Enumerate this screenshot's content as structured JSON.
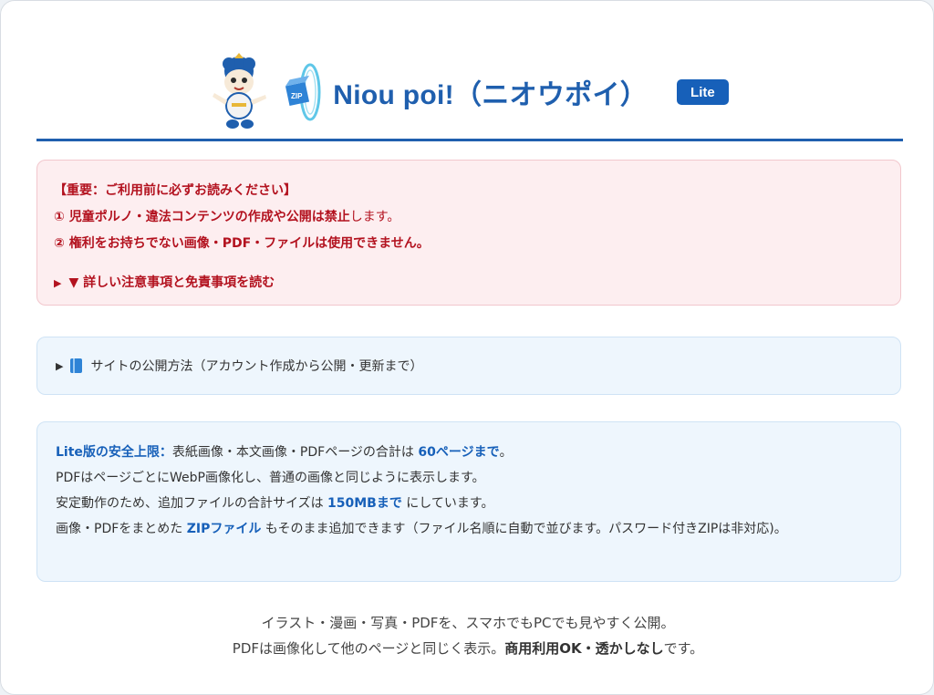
{
  "header": {
    "title": "Niou poi!（ニオウポイ）",
    "badge": "Lite",
    "zip_logo_text": "ZIP"
  },
  "notice": {
    "heading": "【重要：ご利用前に必ずお読みください】",
    "rule1_bold": "① 児童ポルノ・違法コンテンツの作成や公開は禁止",
    "rule1_rest": "します。",
    "rule2": "② 権利をお持ちでない画像・PDF・ファイルは使用できません。",
    "details_toggle": "▼ 詳しい注意事項と免責事項を読む"
  },
  "howto": {
    "icon": "book-icon",
    "label": "サイトの公開方法（アカウント作成から公開・更新まで）"
  },
  "limits": {
    "l1_label": "Lite版の安全上限：",
    "l1_text": "表紙画像・本文画像・PDFページの合計は ",
    "l1_value": "60ページまで",
    "l1_end": "。",
    "l2": "PDFはページごとにWebP画像化し、普通の画像と同じように表示します。",
    "l3_text": "安定動作のため、追加ファイルの合計サイズは ",
    "l3_value": "150MBまで",
    "l3_end": " にしています。",
    "l4_text": "画像・PDFをまとめた ",
    "l4_value": "ZIPファイル",
    "l4_end": " もそのまま追加できます（ファイル名順に自動で並びます。パスワード付きZIPは非対応)。"
  },
  "footer": {
    "line1": "イラスト・漫画・写真・PDFを、スマホでもPCでも見やすく公開。",
    "line2_start": "PDFは画像化して他のページと同じく表示。",
    "line2_bold": "商用利用OK・透かしなし",
    "line2_end": "です。"
  },
  "colors": {
    "brand_blue": "#1760b9",
    "alert_red": "#b3121f"
  }
}
